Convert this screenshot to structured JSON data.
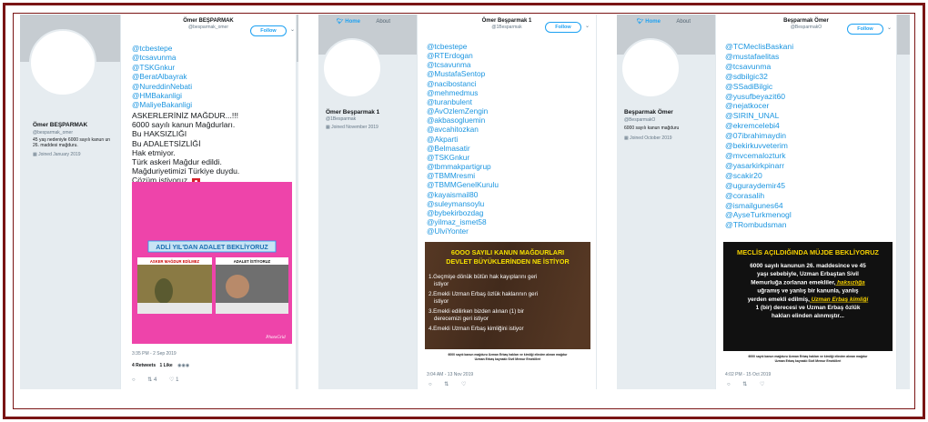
{
  "panel1": {
    "profile": {
      "name": "Ömer BEŞPARMAK",
      "handle": "@besparmak_omer",
      "bio": "45 yaş nedeniyle 6000 sayılı kanun un 26. maddesi mağduru.",
      "joined": "Joined January 2019"
    },
    "tweet": {
      "name": "Ömer BEŞPARMAK",
      "handle": "@besparmak_omer",
      "follow_label": "Follow",
      "mentions": [
        "@tcbestepe",
        "@tcsavunma",
        "@TSKGnkur",
        "@BeratAlbayrak",
        "@NureddinNebati",
        "@HMBakanligi",
        "@MaliyeBakanligi"
      ],
      "text_lines": [
        "ASKERLERİNİZ MAĞDUR...!!!",
        "6000 sayılı kanun Mağdurları.",
        "Bu HAKSIZLIĞI",
        "Bu ADALETSİZLİĞİ",
        "Hak etmiyor.",
        "Türk askeri Mağdur edildi.",
        "Mağduriyetimizi Türkiye duydu.",
        "Çözüm istiyoruz."
      ],
      "image": {
        "banner": "ADLİ YIL'DAN ADALET BEKLİYORUZ",
        "left_caption": "ASKER MAĞDUR EDİLMEZ",
        "right_caption": "ADALET İSTİYORUZ",
        "signature": "PhotoGrid"
      },
      "timestamp": "3:35 PM - 2 Sep 2019",
      "retweets": "4 Retweets",
      "likes": "1 Like",
      "reply_count": "",
      "rt_count": "4",
      "like_count": "1"
    }
  },
  "panel2": {
    "nav": {
      "home": "Home",
      "about": "About"
    },
    "profile": {
      "name": "Ömer Beşparmak 1",
      "handle": "@1Besparmak",
      "joined": "Joined November 2019"
    },
    "tweet": {
      "name": "Ömer Beşparmak 1",
      "handle": "@1Besparmak",
      "follow_label": "Follow",
      "mentions": [
        "@tcbestepe",
        "@RTErdogan",
        "@tcsavunma",
        "@MustafaSentop",
        "@nacibostanci",
        "@mehmedmus",
        "@turanbulent",
        "@AvOzlemZengin",
        "@akbasogluemin",
        "@avcahitozkan",
        "@Akparti",
        "@Belmasatir",
        "@TSKGnkur",
        "@tbmmakpartigrup",
        "@TBMMresmi",
        "@TBMMGenelKurulu",
        "@kayaismail80",
        "@suleymansoylu",
        "@bybekirbozdag",
        "@yilmaz_ismet58",
        "@UlviYonter"
      ],
      "image": {
        "title_line1": "6OOO SAYILI KANUN MAĞDURLARI",
        "title_line2": "DEVLET BÜYÜKLERİNDEN NE İSTİYOR",
        "items": [
          "1.Geçmişe dönük bütün hak kayıplarını geri istiyor",
          "2.Emekli Uzman Erbaş özlük haklarının geri istiyor",
          "3.Emekli edilirken bizden alınan (1) bir derecemizi geri istiyor",
          "4.Emekli Uzman Erbaş kimliğini istiyor"
        ],
        "footer": "6000 sayılı kanun mağduru Uzman Erbaş hakları ve kimliği elinden alınan mağdur Uzman Erbaş kaynaklı Sivil Memur Emeklileri"
      },
      "timestamp": "3:04 AM - 13 Nov 2019"
    }
  },
  "panel3": {
    "nav": {
      "home": "Home",
      "about": "About"
    },
    "profile": {
      "name": "Beşparmak Ömer",
      "handle": "@BesparmakO",
      "bio": "6000 sayılı kanun mağduru",
      "joined": "Joined October 2019"
    },
    "tweet": {
      "name": "Beşparmak Ömer",
      "handle": "@BesparmakO",
      "follow_label": "Follow",
      "mentions": [
        "@TCMeclisBaskani",
        "@mustafaelitas",
        "@tcsavunma",
        "@sdbilgic32",
        "@SSadiBilgic",
        "@yusufbeyazit60",
        "@nejatkocer",
        "@SIRIN_UNAL",
        "@ekremcelebi4",
        "@07ibrahimaydin",
        "@bekirkuvveterim",
        "@mvcemalozturk",
        "@yasarkirkpinarr",
        "@scakir20",
        "@uguraydemir45",
        "@corasalih",
        "@ismailgunes64",
        "@AyseTurkmenogl",
        "@TRombudsman"
      ],
      "image": {
        "title": "MECLİS AÇILDIĞINDA MÜJDE BEKLİYORUZ",
        "text_before": "6000 sayılı kanunun 26. maddesince ve 45 yaşı sebebiyle, Uzman Erbaştan Sivil Memurluğa zorlanan emekliler,",
        "highlight1": "haksızlığa",
        "text_middle": "uğramış ve yanlış bir kanunla, yanlış yerden emekli edilmiş,",
        "highlight2": "Uzman Erbaş kimliği",
        "text_after": "1 (bir) derecesi ve Uzman Erbaş özlük hakları elinden alınmıştır...",
        "footer": "6000 sayılı kanun mağduru Uzman Erbaş hakları ve kimliği elinden alınan mağdur Uzman Erbaş kaynaklı Sivil Memur Emeklileri"
      },
      "timestamp": "4:02 PM - 15 Oct 2019"
    }
  },
  "colors": {
    "frame": "#7a1414",
    "link": "#1b95e0",
    "pink_image_bg": "#ee44aa",
    "brown_image_bg": "#4a3020",
    "black_image_bg": "#111111",
    "highlight_yellow": "#f5d000"
  }
}
